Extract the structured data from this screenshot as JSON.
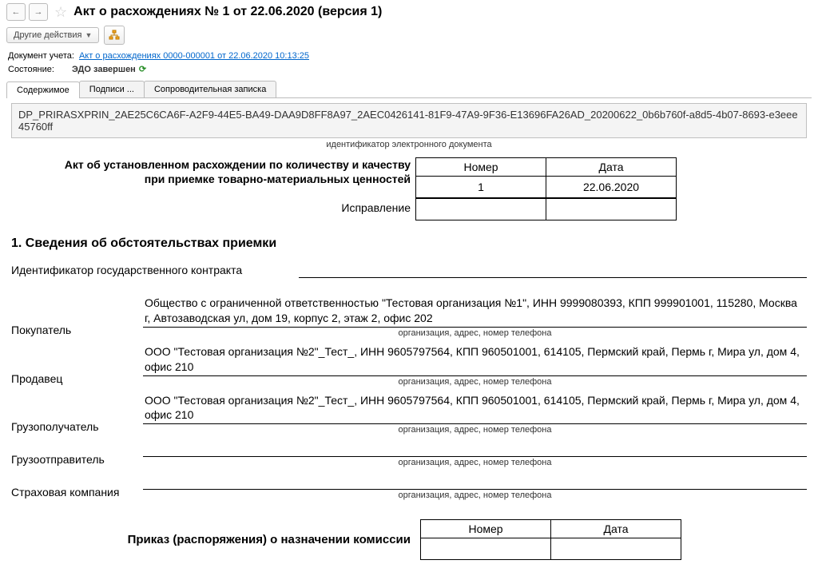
{
  "title": "Акт о расхождениях № 1 от 22.06.2020 (версия 1)",
  "toolbar": {
    "other_actions": "Другие действия"
  },
  "meta": {
    "doc_label": "Документ учета:",
    "doc_link": "Акт о расхождениях 0000-000001 от 22.06.2020 10:13:25",
    "state_label": "Состояние:",
    "state_value": "ЭДО завершен"
  },
  "tabs": {
    "content": "Содержимое",
    "signatures": "Подписи ...",
    "memo": "Сопроводительная записка"
  },
  "doc_id": "DP_PRIRASXPRIN_2AE25C6CA6F-A2F9-44E5-BA49-DAA9D8FF8A97_2AEC0426141-81F9-47A9-9F36-E13696FA26AD_20200622_0b6b760f-a8d5-4b07-8693-e3eee45760ff",
  "doc_id_caption": "идентификатор электронного документа",
  "act_header": {
    "line1": "Акт об установленном расхождении по количеству и качеству",
    "line2": "при приемке товарно-материальных ценностей",
    "number_h": "Номер",
    "date_h": "Дата",
    "number_v": "1",
    "date_v": "22.06.2020",
    "correction": "Исправление"
  },
  "section1_title": "1. Сведения об обстоятельствах приемки",
  "fields": {
    "gov_contract": {
      "label": "Идентификатор государственного контракта",
      "value": ""
    },
    "buyer": {
      "label": "Покупатель",
      "value": "Общество с ограниченной ответственностью \"Тестовая организация №1\", ИНН 9999080393, КПП 999901001, 115280, Москва г, Автозаводская ул, дом 19, корпус 2, этаж 2, офис 202"
    },
    "seller": {
      "label": "Продавец",
      "value": "ООО \"Тестовая организация №2\"_Тест_, ИНН 9605797564, КПП 960501001, 614105, Пермский край, Пермь г, Мира ул, дом 4, офис 210"
    },
    "consignee": {
      "label": "Грузополучатель",
      "value": "ООО \"Тестовая организация №2\"_Тест_, ИНН 9605797564, КПП 960501001, 614105, Пермский край, Пермь г, Мира ул, дом 4, офис 210"
    },
    "shipper": {
      "label": "Грузоотправитель",
      "value": ""
    },
    "insurance": {
      "label": "Страховая компания",
      "value": ""
    },
    "hint": "организация, адрес, номер телефона"
  },
  "order": {
    "label": "Приказ (распоряжения) о назначении комиссии",
    "number_h": "Номер",
    "date_h": "Дата"
  }
}
